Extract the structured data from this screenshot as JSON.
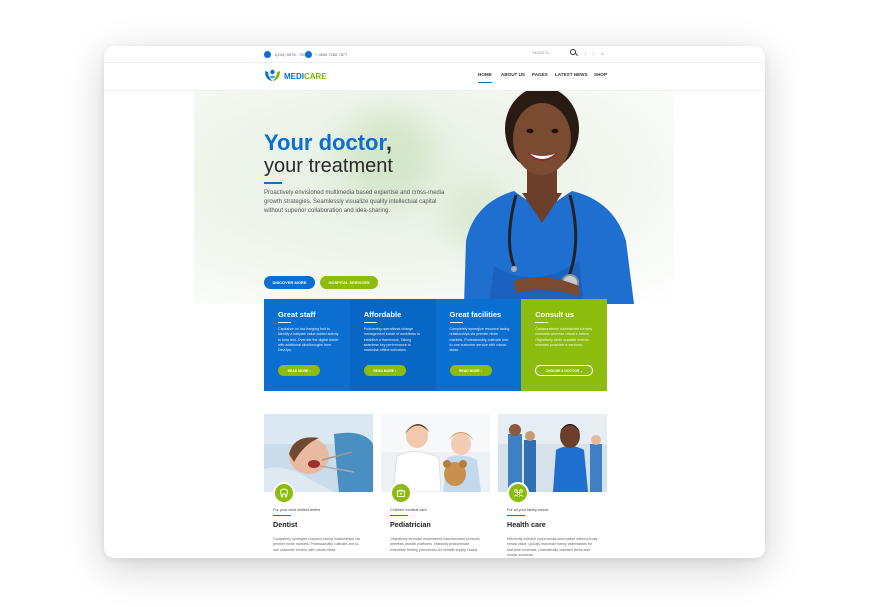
{
  "topbar": {
    "phone": "1(234) 5678 - 7893",
    "email": "+ 4806 7285 7877",
    "search_placeholder": "SEARCH..."
  },
  "nav": {
    "logo_a": "MEDI",
    "logo_b": "CARE",
    "items": [
      "HOME",
      "ABOUT US",
      "PAGES",
      "LATEST NEWS",
      "SHOP"
    ]
  },
  "hero": {
    "title": "Your doctor",
    "comma": ",",
    "subtitle": "your treatment",
    "paragraph": "Proactively envisioned multimedia based expertise and cross-media growth strategies. Seamlessly visualize quality intellectual capital without superior collaboration and idea-sharing.",
    "btn1": "DISCOVER MORE",
    "btn2": "HOSPITAL SERVICES"
  },
  "features": [
    {
      "title": "Great staff",
      "text": "Capitalize on low hanging fruit to identify a ballpark value added activity to beta test. Override the digital divide with additional clickthroughs from DevOps.",
      "button": "READ MORE  ›"
    },
    {
      "title": "Affordable",
      "text": "Podcasting operational change management inside of workflows to establish a framework. Taking seamless key performance to maximise offline indicators.",
      "button": "READ MORE  ›"
    },
    {
      "title": "Great facilities",
      "text": "Completely synergize resource taxing relationships via premier niche markets. Professionally cultivate one-to-one customer service with robust ideas.",
      "button": "READ MORE  ›"
    },
    {
      "title": "Consult us",
      "text": "Collaboratively administrate turnkey channels whereas virtual e-tailers. Objectively seize scalable metrics whereas proactive e-services.",
      "button": "CHOOSE A DOCTOR  ⌄"
    }
  ],
  "services": [
    {
      "sub": "For your child whitest teeths",
      "title": "Dentist",
      "text": "Completely synergize resource taxing relationships via premier niche markets. Professionally cultivate one-to-one customer service with robust ideas."
    },
    {
      "sub": "Children medical care",
      "title": "Pediatrician",
      "text": "Objectively innovate empowered manufactured products whereas parallel platforms. Holisticly predominate extensible testing procedures for reliable supply chains."
    },
    {
      "sub": "For all your family needs",
      "title": "Health care",
      "text": "Efficiently unleash cross-media information without cross-media value. Quickly maximize timely deliverables for real-time schemas. Dramatically maintain clicks-and-mortar solutions."
    }
  ],
  "colors": {
    "primary": "#0a6fd1",
    "accent": "#8cbd0e"
  }
}
